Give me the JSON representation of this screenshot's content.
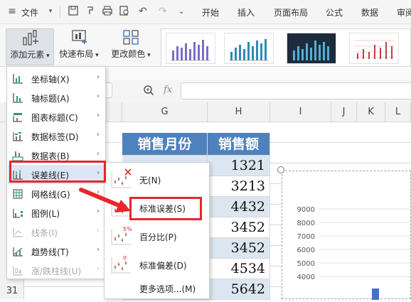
{
  "menubar": {
    "file_label": "文件",
    "tabs": [
      "开始",
      "插入",
      "页面布局",
      "公式",
      "数据",
      "审阅"
    ]
  },
  "ribbon": {
    "add_element_label": "添加元素",
    "quick_layout_label": "快速布局",
    "change_color_label": "更改颜色"
  },
  "formula_bar": {
    "fx_label": "fx"
  },
  "columns": [
    "G",
    "H",
    "I",
    "J",
    "K",
    "L"
  ],
  "row_number": "31",
  "table": {
    "header_month": "销售月份",
    "header_sales": "销售额",
    "values": [
      "1321",
      "3213",
      "4432",
      "3452",
      "3452",
      "4534",
      "5642"
    ]
  },
  "chart": {
    "y_ticks": [
      "9000",
      "8000",
      "7000",
      "6000",
      "5000",
      "4000"
    ]
  },
  "element_menu": {
    "items": [
      {
        "label": "坐标轴(X)",
        "icon": "axis-icon",
        "disabled": false
      },
      {
        "label": "轴标题(A)",
        "icon": "axis-title-icon",
        "disabled": false
      },
      {
        "label": "图表标题(C)",
        "icon": "chart-title-icon",
        "disabled": false
      },
      {
        "label": "数据标签(D)",
        "icon": "data-labels-icon",
        "disabled": false
      },
      {
        "label": "数据表(B)",
        "icon": "data-table-icon",
        "disabled": false
      },
      {
        "label": "误差线(E)",
        "icon": "error-bars-icon",
        "disabled": false
      },
      {
        "label": "网格线(G)",
        "icon": "gridlines-icon",
        "disabled": false
      },
      {
        "label": "图例(L)",
        "icon": "legend-icon",
        "disabled": false
      },
      {
        "label": "线条(I)",
        "icon": "lines-icon",
        "disabled": true
      },
      {
        "label": "趋势线(T)",
        "icon": "trendline-icon",
        "disabled": false
      },
      {
        "label": "涨/跌柱线(U)",
        "icon": "up-down-bars-icon",
        "disabled": true
      }
    ]
  },
  "error_bar_menu": {
    "items": [
      {
        "label": "无(N)",
        "badge": "✕"
      },
      {
        "label": "标准误差(S)",
        "badge": ""
      },
      {
        "label": "百分比(P)",
        "badge": "5%"
      },
      {
        "label": "标准偏差(D)",
        "badge": "σ"
      }
    ],
    "more_label": "更多选项...(M)"
  },
  "colors": {
    "table_header_bg": "#4f81bd",
    "table_band": "#dce6f1",
    "highlight": "#e8262c",
    "selected_item_bg": "#dbe7f5"
  }
}
